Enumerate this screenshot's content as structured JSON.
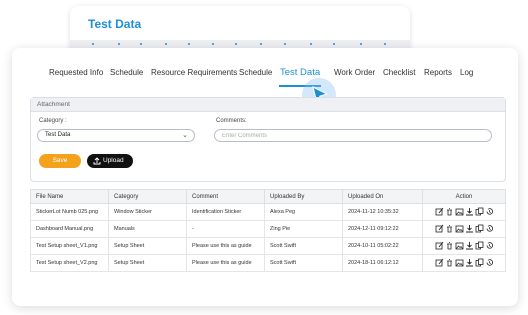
{
  "background_card": {
    "title": "Test Data"
  },
  "tabs": [
    {
      "label": "Requested Info"
    },
    {
      "label": "Schedule"
    },
    {
      "label": "Resource Requirements"
    },
    {
      "label": "Schedule"
    },
    {
      "label": "Test Data"
    },
    {
      "label": "Work Order"
    },
    {
      "label": "Checklist"
    },
    {
      "label": "Reports"
    },
    {
      "label": "Log"
    }
  ],
  "active_tab": "Test Data",
  "attachment": {
    "header": "Attachment",
    "category_label": "Category :",
    "category_value": "Test Data",
    "comments_label": "Comments:",
    "comments_placeholder": "Enter Comments",
    "save_label": "Save",
    "upload_label": "Upload"
  },
  "table": {
    "headers": [
      "File Name",
      "Category",
      "Comment",
      "Uploaded By",
      "Uploaded On",
      "Action"
    ],
    "rows": [
      [
        "StickerLot Numb 025.png",
        "Window Sticker",
        "Identification Sticker",
        "Alexa Peg",
        "2024-11-12 10:35:32"
      ],
      [
        "Dashboard Manual.png",
        "Manuals",
        "-",
        "Zing Pie",
        "2024-12-11 09:12:22"
      ],
      [
        "Test Setup sheet_V1.png",
        "Setup Sheet",
        "Please use this as guide",
        "Scott Swift",
        "2024-10-11 05:02:22"
      ],
      [
        "Test Setup sheet_V2.png",
        "Setup Sheet",
        "Please use this as guide",
        "Scott Swift",
        "2024-18-11 06:12:12"
      ]
    ]
  },
  "icons": {
    "actions": [
      "edit-icon",
      "delete-icon",
      "image-icon",
      "download-icon",
      "copy-icon",
      "history-icon"
    ],
    "cursor": "pointer-cursor-icon"
  },
  "colors": {
    "accent": "#1e8fd6",
    "save": "#f4a21c",
    "upload": "#111111"
  }
}
